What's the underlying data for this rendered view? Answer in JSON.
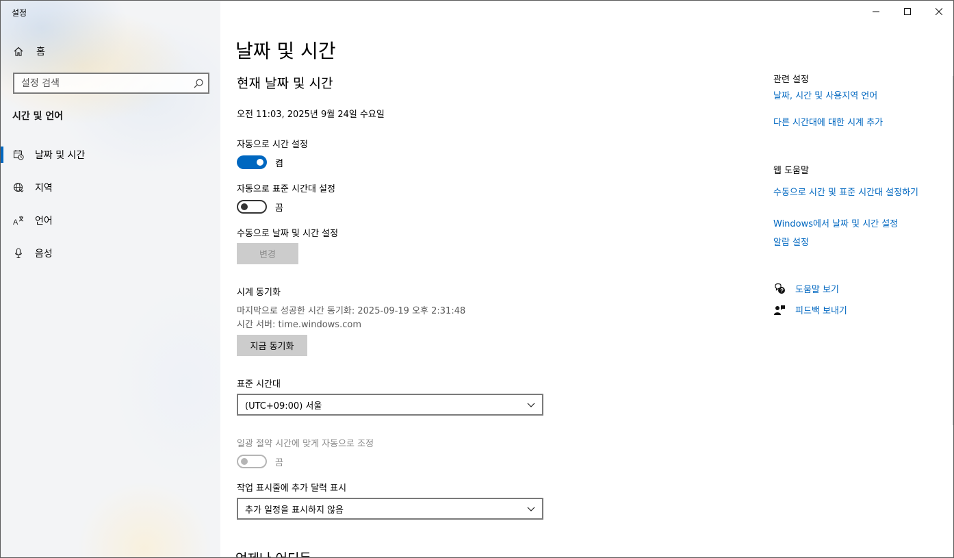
{
  "window": {
    "title": "설정"
  },
  "sidebar": {
    "home_label": "홈",
    "search_placeholder": "설정 검색",
    "section_title": "시간 및 언어",
    "items": [
      {
        "label": "날짜 및 시간",
        "icon": "calendar-clock-icon",
        "active": true
      },
      {
        "label": "지역",
        "icon": "globe-icon",
        "active": false
      },
      {
        "label": "언어",
        "icon": "language-icon",
        "active": false
      },
      {
        "label": "음성",
        "icon": "microphone-icon",
        "active": false
      }
    ]
  },
  "main": {
    "page_title": "날짜 및 시간",
    "current_heading": "현재 날짜 및 시간",
    "current_datetime": "오전 11:03, 2025년 9월 24일 수요일",
    "auto_time": {
      "label": "자동으로 시간 설정",
      "state": "켬",
      "on": true
    },
    "auto_timezone": {
      "label": "자동으로 표준 시간대 설정",
      "state": "끔",
      "on": false
    },
    "manual": {
      "label": "수동으로 날짜 및 시간 설정",
      "button": "변경"
    },
    "sync": {
      "heading": "시계 동기화",
      "last_sync": "마지막으로 성공한 시간 동기화: 2025-09-19 오후 2:31:48",
      "server": "시간 서버: time.windows.com",
      "button": "지금 동기화"
    },
    "timezone": {
      "label": "표준 시간대",
      "value": "(UTC+09:00) 서울"
    },
    "dst": {
      "label": "일광 절약 시간에 맞게 자동으로 조정",
      "state": "끔",
      "disabled": true
    },
    "calendar": {
      "label": "작업 표시줄에 추가 달력 표시",
      "value": "추가 일정을 표시하지 않음"
    },
    "cut_heading": "언제나 어디든"
  },
  "right": {
    "related_heading": "관련 설정",
    "related_links": [
      "날짜, 시간 및 사용지역 언어",
      "다른 시간대에 대한 시계 추가"
    ],
    "web_help_heading": "웹 도움말",
    "help_links": [
      "수동으로 시간 및 표준 시간대 설정하기",
      "Windows에서 날짜 및 시간 설정",
      "알람 설정"
    ],
    "get_help": "도움말 보기",
    "feedback": "피드백 보내기"
  },
  "colors": {
    "accent": "#0067c0",
    "disabled_text": "#8a8a8a",
    "button_bg": "#cccccc"
  }
}
